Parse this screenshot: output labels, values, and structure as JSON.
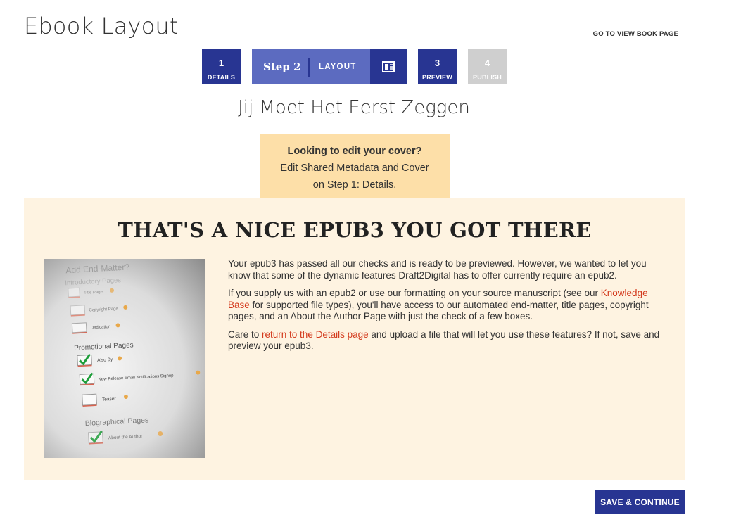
{
  "header": {
    "title": "Ebook Layout",
    "view_book_link": "GO TO VIEW BOOK PAGE"
  },
  "steps": [
    {
      "number": "1",
      "label": "DETAILS",
      "state": "completed"
    },
    {
      "number": "Step 2",
      "label": "LAYOUT",
      "state": "active",
      "icon": "layout-icon"
    },
    {
      "number": "3",
      "label": "PREVIEW",
      "state": "upcoming"
    },
    {
      "number": "4",
      "label": "PUBLISH",
      "state": "disabled"
    }
  ],
  "book_title": "Jij Moet Het Eerst Zeggen",
  "notice": {
    "heading": "Looking to edit your cover?",
    "line1": "Edit Shared Metadata and Cover",
    "line2": "on Step 1: Details."
  },
  "panel": {
    "heading": "THAT'S A NICE EPUB3 YOU GOT THERE",
    "thumbnail": {
      "title": "Add End-Matter?",
      "sections": [
        {
          "label": "Introductory Pages",
          "items": [
            {
              "label": "Title Page",
              "checked": false
            },
            {
              "label": "Copyright Page",
              "checked": false
            },
            {
              "label": "Dedication",
              "checked": false
            }
          ]
        },
        {
          "label": "Promotional Pages",
          "items": [
            {
              "label": "Also By",
              "checked": true
            },
            {
              "label": "New Release Email Notifications Signup",
              "checked": true
            },
            {
              "label": "Teaser",
              "checked": false
            }
          ]
        },
        {
          "label": "Biographical Pages",
          "items": [
            {
              "label": "About the Author",
              "checked": true
            }
          ]
        }
      ]
    },
    "para1": "Your epub3 has passed all our checks and is ready to be previewed. However, we wanted to let you know that some of the dynamic features Draft2Digital has to offer currently require an epub2.",
    "para2_before": "If you supply us with an epub2 or use our formatting on your source manuscript (see our ",
    "para2_link": "Knowledge Base",
    "para2_after": " for supported file types), you'll have access to our automated end-matter, title pages, copyright pages, and an About the Author Page with just the check of a few boxes.",
    "para3_before": "Care to ",
    "para3_link": "return to the Details page",
    "para3_after": " and upload a file that will let you use these features? If not, save and preview your epub3."
  },
  "actions": {
    "save_continue": "SAVE & CONTINUE"
  },
  "colors": {
    "primary": "#283592",
    "step_active": "#5c6bc0",
    "step_disabled": "#cfcfcf",
    "notice_bg": "#fddfa8",
    "panel_bg": "#fef3e1",
    "link": "#d3391c"
  }
}
